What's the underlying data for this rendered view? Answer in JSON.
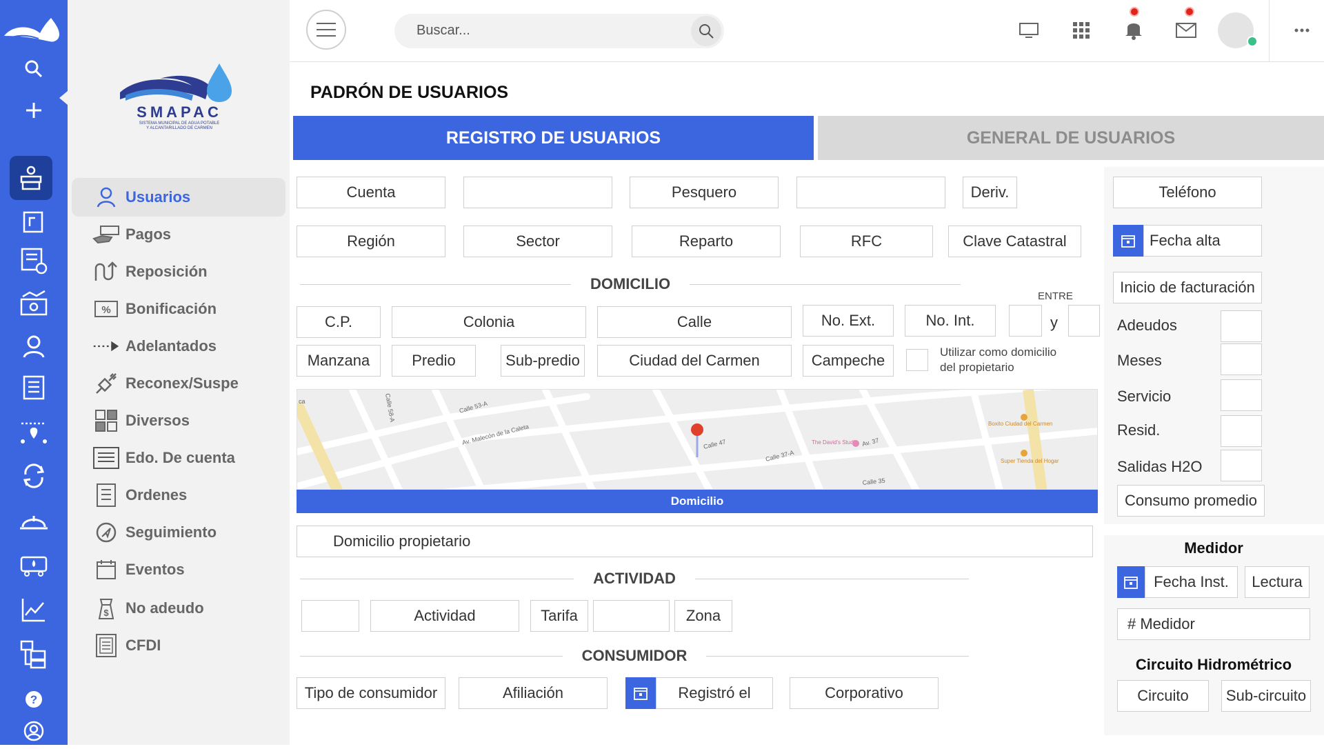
{
  "topbar": {
    "search_placeholder": "Buscar..."
  },
  "brand": {
    "name": "SMAPAC",
    "tagline_1": "SISTEMA MUNICIPAL DE AGUA POTABLE",
    "tagline_2": "Y ALCANTARILLADO DE CARMEN"
  },
  "sidebar": {
    "items": [
      {
        "label": "Usuarios",
        "icon": "user-icon"
      },
      {
        "label": "Pagos",
        "icon": "payment-hand-icon"
      },
      {
        "label": "Reposición",
        "icon": "return-arrow-icon"
      },
      {
        "label": "Bonificación",
        "icon": "percent-icon"
      },
      {
        "label": "Adelantados",
        "icon": "dotted-arrow-icon"
      },
      {
        "label": "Reconex/Suspe",
        "icon": "plug-icon"
      },
      {
        "label": "Diversos",
        "icon": "grid-icon"
      },
      {
        "label": "Edo. De cuenta",
        "icon": "statement-icon"
      },
      {
        "label": "Ordenes",
        "icon": "document-list-icon"
      },
      {
        "label": "Seguimiento",
        "icon": "navigation-icon"
      },
      {
        "label": "Eventos",
        "icon": "calendar-icon"
      },
      {
        "label": "No adeudo",
        "icon": "money-bag-icon"
      },
      {
        "label": "CFDI",
        "icon": "invoice-icon"
      }
    ]
  },
  "page": {
    "title": "PADRÓN DE USUARIOS",
    "tab_active": "REGISTRO DE USUARIOS",
    "tab_inactive": "GENERAL DE USUARIOS"
  },
  "form": {
    "cuenta": "Cuenta",
    "pesquero": "Pesquero",
    "deriv": "Deriv.",
    "region": "Región",
    "sector": "Sector",
    "reparto": "Reparto",
    "rfc": "RFC",
    "clave_catastral": "Clave Catastral",
    "sec_domicilio": "DOMICILIO",
    "entre": "ENTRE",
    "y": "y",
    "cp": "C.P.",
    "colonia": "Colonia",
    "calle": "Calle",
    "no_ext": "No. Ext.",
    "no_int": "No. Int.",
    "manzana": "Manzana",
    "predio": "Predio",
    "sub_predio": "Sub-predio",
    "ciudad": "Ciudad del Carmen",
    "estado": "Campeche",
    "usar_domicilio_1": "Utilizar como domicilio",
    "usar_domicilio_2": "del propietario",
    "map_bar": "Domicilio",
    "domicilio_propietario": "Domicilio propietario",
    "sec_actividad": "ACTIVIDAD",
    "actividad": "Actividad",
    "tarifa": "Tarifa",
    "zona": "Zona",
    "sec_consumidor": "CONSUMIDOR",
    "tipo_consumidor": "Tipo de consumidor",
    "afiliacion": "Afiliación",
    "registro_el": "Registró el",
    "corporativo": "Corporativo"
  },
  "map": {
    "streets": [
      "Av. Malecón de la Caleta",
      "Calle 53-A",
      "Calle 47",
      "Calle 37-A",
      "Av. 37",
      "Calle 35",
      "Calle 58-A",
      "ca"
    ],
    "places": [
      "The David's Studio",
      "Boxito Ciudad del Carmen",
      "Super Tienda del Hogar"
    ]
  },
  "right": {
    "telefono": "Teléfono",
    "fecha_alta": "Fecha alta",
    "inicio_facturacion": "Inicio de facturación",
    "adeudos": "Adeudos",
    "meses": "Meses",
    "servicio": "Servicio",
    "resid": "Resid.",
    "salidas_h2o": "Salidas H2O",
    "consumo_promedio": "Consumo promedio",
    "medidor_title": "Medidor",
    "fecha_inst": "Fecha Inst.",
    "lectura": "Lectura",
    "num_medidor": "# Medidor",
    "circuito_title": "Circuito Hidrométrico",
    "circuito": "Circuito",
    "sub_circuito": "Sub-circuito"
  },
  "colors": {
    "accent": "#3b66e0",
    "rail": "#3b66e0",
    "notification": "#e0241b",
    "online": "#3cc08a"
  }
}
